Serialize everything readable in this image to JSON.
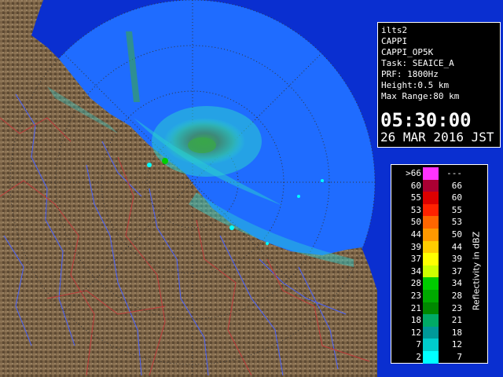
{
  "info": {
    "lines": [
      "ilts2",
      "CAPPI",
      "CAPPI_OP5K",
      "Task: SEAICE_A",
      "PRF: 1800Hz",
      "Height:0.5 km",
      "Max Range:80 km"
    ],
    "time": "05:30:00",
    "date": "26 MAR 2016 JST"
  },
  "legend": {
    "unit_label": "Reflectivity in dBZ",
    "rows": [
      {
        "lo": ">66",
        "hi": "---",
        "color": "#ff33ff"
      },
      {
        "lo": "60",
        "hi": "66",
        "color": "#aa0033"
      },
      {
        "lo": "55",
        "hi": "60",
        "color": "#dd0000"
      },
      {
        "lo": "53",
        "hi": "55",
        "color": "#ff2200"
      },
      {
        "lo": "50",
        "hi": "53",
        "color": "#ff6600"
      },
      {
        "lo": "44",
        "hi": "50",
        "color": "#ff9900"
      },
      {
        "lo": "39",
        "hi": "44",
        "color": "#ffcc00"
      },
      {
        "lo": "37",
        "hi": "39",
        "color": "#ffff00"
      },
      {
        "lo": "34",
        "hi": "37",
        "color": "#ccff00"
      },
      {
        "lo": "28",
        "hi": "34",
        "color": "#00cc00"
      },
      {
        "lo": "23",
        "hi": "28",
        "color": "#00aa00"
      },
      {
        "lo": "21",
        "hi": "23",
        "color": "#008800"
      },
      {
        "lo": "18",
        "hi": "21",
        "color": "#00aa66"
      },
      {
        "lo": "12",
        "hi": "18",
        "color": "#009999"
      },
      {
        "lo": "7",
        "hi": "12",
        "color": "#00cccc"
      },
      {
        "lo": "2",
        "hi": "7",
        "color": "#00ffff"
      }
    ]
  },
  "colors": {
    "land": "#7a6245",
    "sea": "#0a2fd0",
    "radar_disc": "#1f6cff",
    "rivers": "#4a63ff",
    "boundaries": "#c23a3a"
  }
}
